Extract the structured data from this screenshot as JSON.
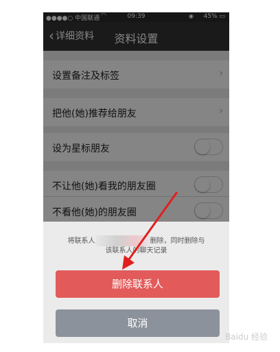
{
  "status_bar": {
    "carrier": "●●●●○ 中国联通",
    "wifi": "◠",
    "time": "09:39",
    "battery": "45%"
  },
  "nav": {
    "back_label": "详细资料",
    "title": "资料设置"
  },
  "rows": [
    {
      "label": "设置备注及标签"
    },
    {
      "label": "把他(她)推荐给朋友"
    },
    {
      "label": "设为星标朋友"
    },
    {
      "label": "不让他(她)看我的朋友圈"
    },
    {
      "label": "不看他(她)的朋友圈"
    }
  ],
  "sheet": {
    "message_line1_prefix": "将联系人",
    "message_line1_suffix": "删除，同时删除与",
    "message_line2": "该联系人的聊天记录",
    "delete_label": "删除联系人",
    "cancel_label": "取消"
  },
  "colors": {
    "delete": "#e25a5a",
    "cancel": "#8c929b",
    "nav": "#333333",
    "arrow": "#e0201e"
  },
  "watermark": "Baidu 经验"
}
